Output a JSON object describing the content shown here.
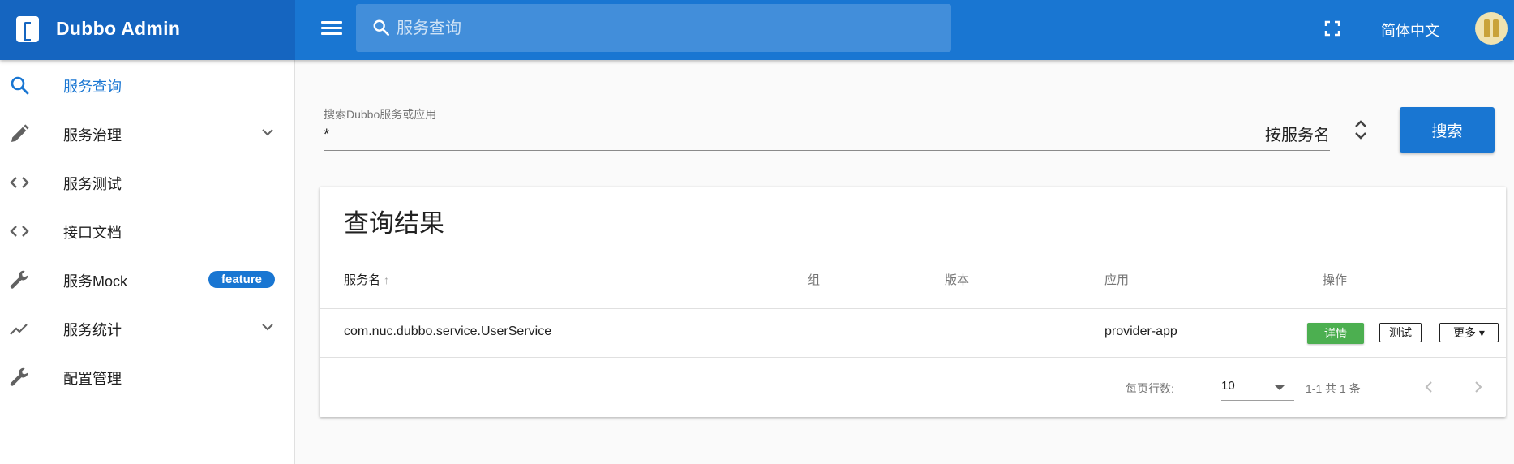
{
  "header": {
    "brand": "Dubbo Admin",
    "search_placeholder": "服务查询",
    "language": "简体中文"
  },
  "sidebar": {
    "items": [
      {
        "label": "服务查询",
        "icon": "search-icon",
        "active": true
      },
      {
        "label": "服务治理",
        "icon": "pencil-icon",
        "expandable": true
      },
      {
        "label": "服务测试",
        "icon": "code-icon"
      },
      {
        "label": "接口文档",
        "icon": "code-icon"
      },
      {
        "label": "服务Mock",
        "icon": "wrench-icon",
        "badge": "feature"
      },
      {
        "label": "服务统计",
        "icon": "trending-up-icon",
        "expandable": true
      },
      {
        "label": "配置管理",
        "icon": "wrench-icon"
      }
    ]
  },
  "search": {
    "label": "搜索Dubbo服务或应用",
    "value": "*",
    "mode": "按服务名",
    "button": "搜索"
  },
  "results": {
    "title": "查询结果",
    "columns": [
      "服务名",
      "组",
      "版本",
      "应用",
      "操作"
    ],
    "rows": [
      {
        "service": "com.nuc.dubbo.service.UserService",
        "group": "",
        "version": "",
        "app": "provider-app"
      }
    ],
    "actions": {
      "detail": "详情",
      "test": "测试",
      "more": "更多"
    },
    "footer": {
      "rows_per_page_label": "每页行数:",
      "rows_per_page": "10",
      "page_info": "1-1 共 1 条"
    }
  },
  "colors": {
    "primary": "#1976d2",
    "primary_dark": "#1565c0",
    "success": "#4caf50"
  }
}
